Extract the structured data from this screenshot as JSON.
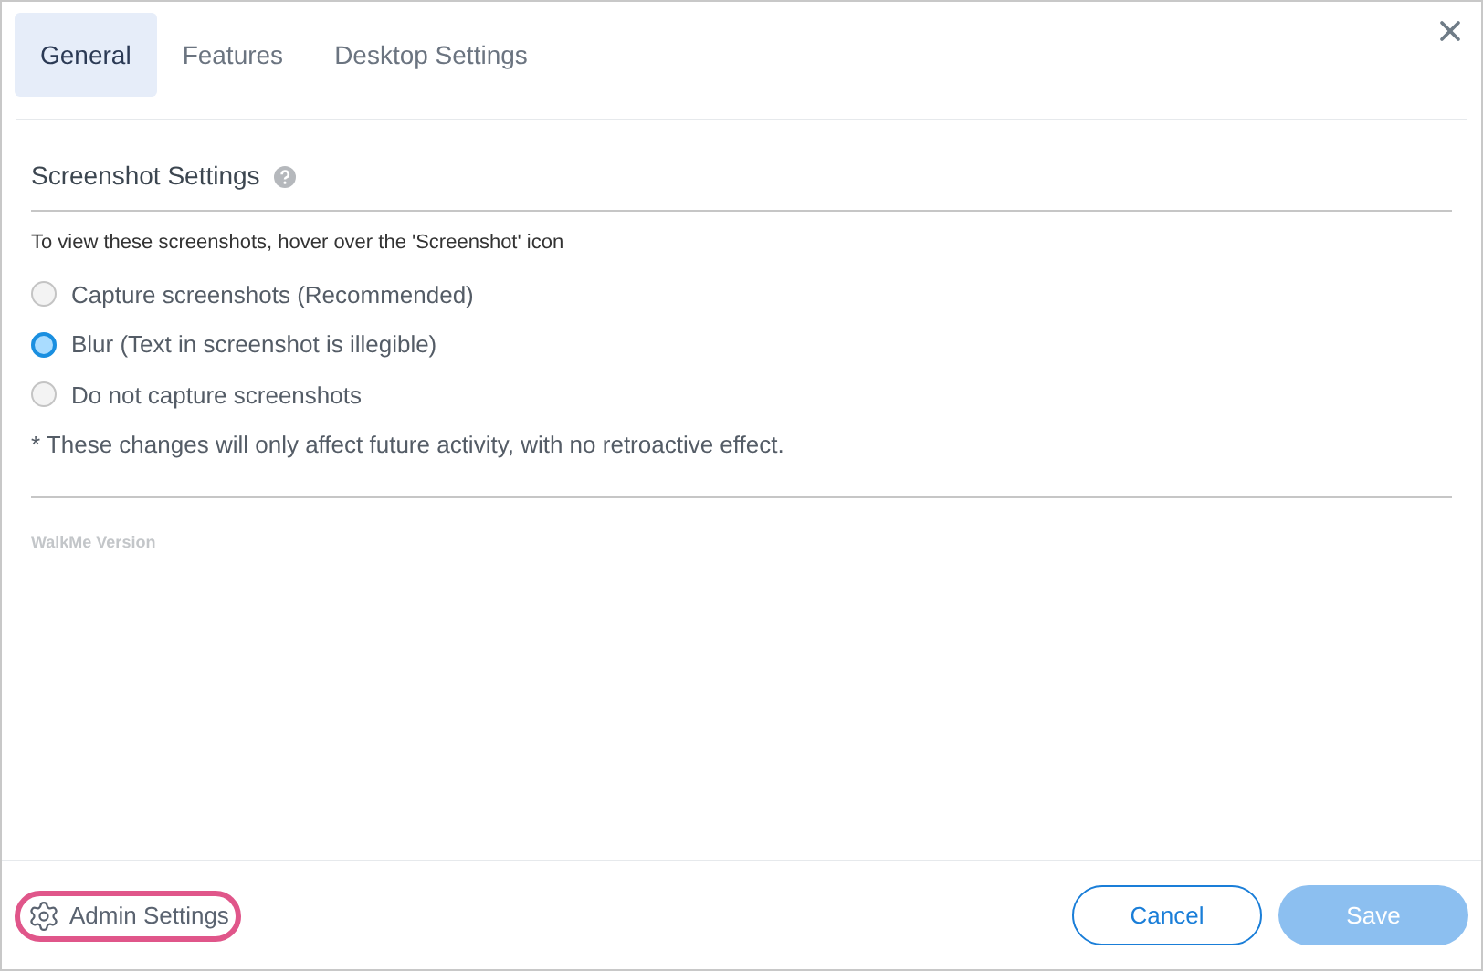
{
  "tabs": [
    {
      "label": "General",
      "selected": true
    },
    {
      "label": "Features",
      "selected": false
    },
    {
      "label": "Desktop Settings",
      "selected": false
    }
  ],
  "section": {
    "title": "Screenshot Settings",
    "hint": "To view these screenshots, hover over the 'Screenshot' icon",
    "options": [
      {
        "label": "Capture screenshots (Recommended)",
        "selected": false
      },
      {
        "label": "Blur (Text in screenshot is illegible)",
        "selected": true
      },
      {
        "label": "Do not capture screenshots",
        "selected": false
      }
    ],
    "note": "* These changes will only affect future activity, with no retroactive effect."
  },
  "version_label": "WalkMe Version",
  "footer": {
    "admin_link": {
      "label": "Admin Settings",
      "highlighted": true
    },
    "cancel": "Cancel",
    "save": {
      "label": "Save",
      "disabled": true
    }
  }
}
